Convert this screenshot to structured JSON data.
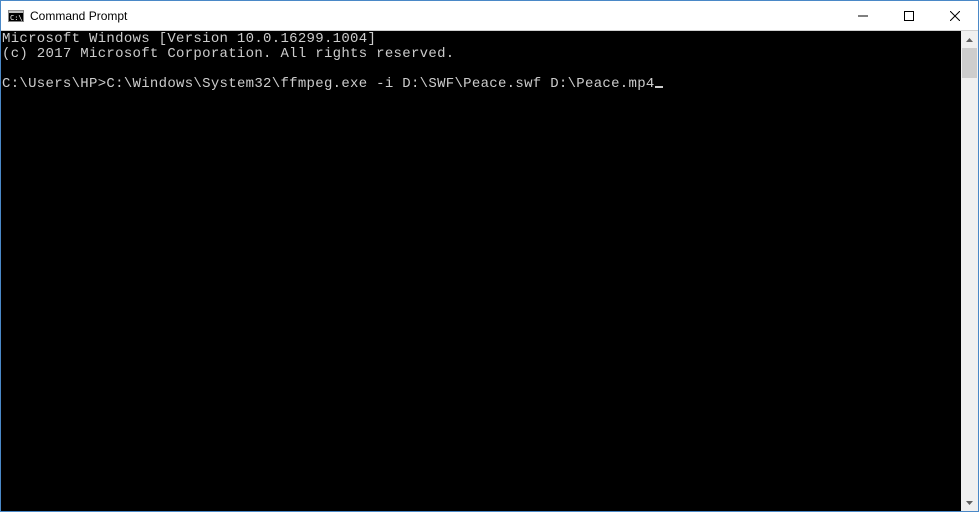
{
  "window": {
    "title": "Command Prompt"
  },
  "terminal": {
    "line1": "Microsoft Windows [Version 10.0.16299.1004]",
    "line2": "(c) 2017 Microsoft Corporation. All rights reserved.",
    "blank": "",
    "prompt": "C:\\Users\\HP>",
    "command": "C:\\Windows\\System32\\ffmpeg.exe -i D:\\SWF\\Peace.swf D:\\Peace.mp4"
  }
}
